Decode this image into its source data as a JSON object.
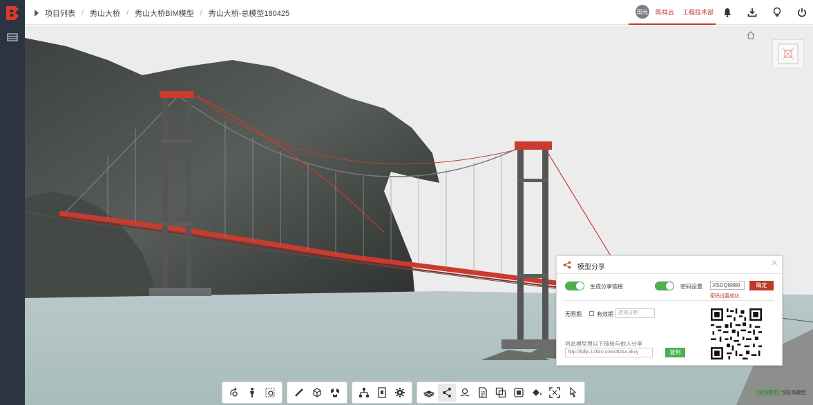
{
  "header": {
    "breadcrumb": [
      "项目列表",
      "秀山大桥",
      "秀山大桥BIM模型",
      "秀山大桥-总模型180425"
    ],
    "user": {
      "avatar_text": "田元",
      "name": "陈祥云",
      "department": "工程技术部"
    },
    "buttons": [
      "bell-icon",
      "download-icon",
      "lightbulb-icon",
      "power-icon"
    ]
  },
  "share_panel": {
    "title": "模型分享",
    "generate_link_label": "生成分享链接",
    "password_label": "密码设置",
    "password_value": "XSDQ8880",
    "confirm_label": "确定",
    "password_status": "密码设置成功",
    "no_limit_label": "无限期",
    "valid_period_label": "有效期",
    "date_placeholder": "选择日期",
    "share_hint": "将此模型用以下链接与他人分享",
    "link_value": "http://bdip.17bim.com/4DAx.akvy",
    "copy_label": "复制",
    "generate_link_on": true,
    "password_on": true
  },
  "status_bar": {
    "badge": "[离线模型]",
    "text": "切在线模型"
  },
  "colors": {
    "accent": "#c0392b",
    "toggle_on": "#4caf50",
    "sidebar": "#2b3440"
  }
}
